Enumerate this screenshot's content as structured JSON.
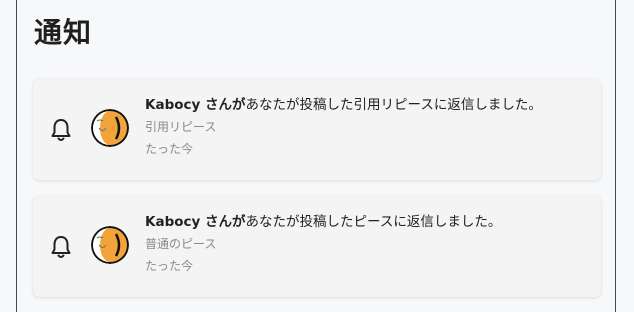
{
  "page": {
    "title": "通知"
  },
  "notifications": [
    {
      "actor": "Kabocy さんが",
      "message": "あなたが投稿した引用リピースに返信しました。",
      "type": "引用リピース",
      "time": "たった今",
      "icon": "bell-icon"
    },
    {
      "actor": "Kabocy さんが",
      "message": "あなたが投稿したピースに返信しました。",
      "type": "普通のピース",
      "time": "たった今",
      "icon": "bell-icon"
    }
  ],
  "colors": {
    "background": "#f7f8fa",
    "card": "#f4f4f4",
    "avatar_orange": "#f2a33a",
    "muted_text": "#8a8a8a"
  }
}
